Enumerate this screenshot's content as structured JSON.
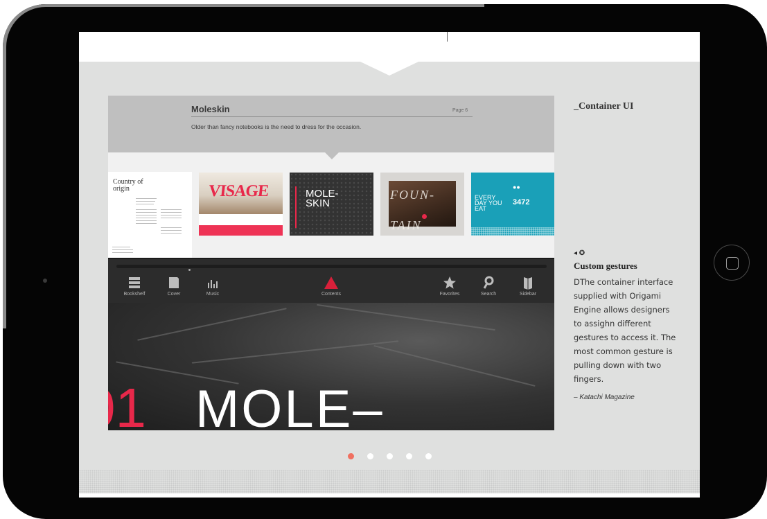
{
  "mockup": {
    "info_panel": {
      "title": "Moleskin",
      "page": "Page 6",
      "description": "Older than fancy notebooks is the need to dress for the occasion."
    },
    "thumbnails": [
      {
        "title": "Country of origin"
      },
      {
        "title": "VISAGE"
      },
      {
        "title": "MOLE- SKIN"
      },
      {
        "title": "FOUN- TAIN HEAD"
      },
      {
        "title": "EVERY DAY YOU EAT",
        "value": "3472"
      }
    ],
    "toolbar": {
      "items": [
        {
          "label": "Bookshelf",
          "icon": "bookshelf-icon"
        },
        {
          "label": "Cover",
          "icon": "cover-icon"
        },
        {
          "label": "Music",
          "icon": "music-icon"
        },
        {
          "label": "Contents",
          "icon": "contents-icon"
        },
        {
          "label": "Favorites",
          "icon": "star-icon"
        },
        {
          "label": "Search",
          "icon": "search-icon"
        },
        {
          "label": "Sidebar",
          "icon": "sidebar-icon"
        }
      ],
      "active_color": "#d8203a"
    },
    "hero": {
      "number": "01",
      "word": "MOLE–"
    }
  },
  "sidebar": {
    "title": "_Container UI",
    "icons": "◂ ✪",
    "gestures_title": "Custom  gestures",
    "gestures_body": "DThe container interface supplied with Origami Engine allows designers to assighn different gestures to access it. The most common gesture is pulling down with two fingers.",
    "credit": "– Katachi Magazine"
  },
  "pager": {
    "count": 5,
    "active_index": 0,
    "active_color": "#f07060"
  }
}
